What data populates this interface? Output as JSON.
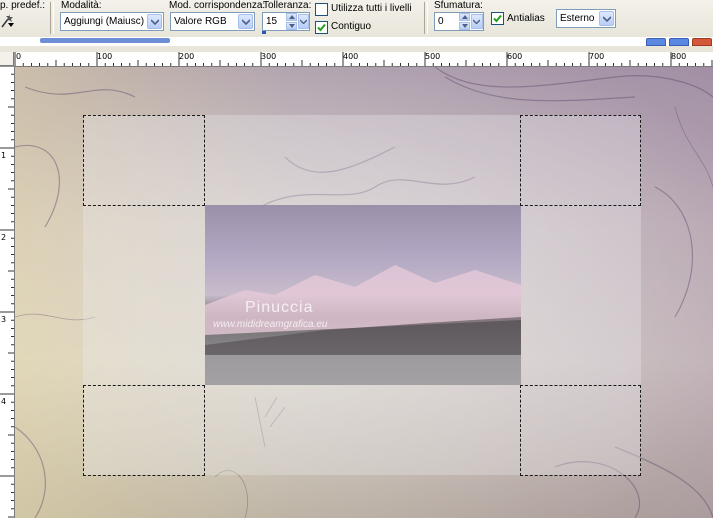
{
  "toolbar": {
    "preset_label": "p. predef.:",
    "mode_label": "Modalità:",
    "mode_value": "Aggiungi (Maiusc)",
    "match_label": "Mod. corrispondenza:",
    "match_value": "Valore RGB",
    "tolerance_label": "Tolleranza:",
    "tolerance_value": "15",
    "all_layers_label": "Utilizza tutti i livelli",
    "all_layers_checked": false,
    "contiguous_label": "Contiguo",
    "contiguous_checked": true,
    "feather_label": "Sfumatura:",
    "feather_value": "0",
    "antialias_label": "Antialias",
    "antialias_checked": true,
    "outside_value": "Esterno"
  },
  "ruler": {
    "h_labels": [
      "0",
      "100",
      "200",
      "300",
      "400",
      "500",
      "600",
      "700",
      "800"
    ],
    "v_labels": [
      "1",
      "2",
      "3",
      "4"
    ]
  },
  "canvas": {
    "watermark_name": "Pinuccia",
    "watermark_url": "www.mididreamgrafica.eu"
  },
  "icons": {
    "wand": "magic-wand-icon",
    "dropdown": "chevron-down-icon",
    "spin_up": "spin-up-icon",
    "spin_down": "spin-down-icon",
    "check": "check-icon"
  }
}
